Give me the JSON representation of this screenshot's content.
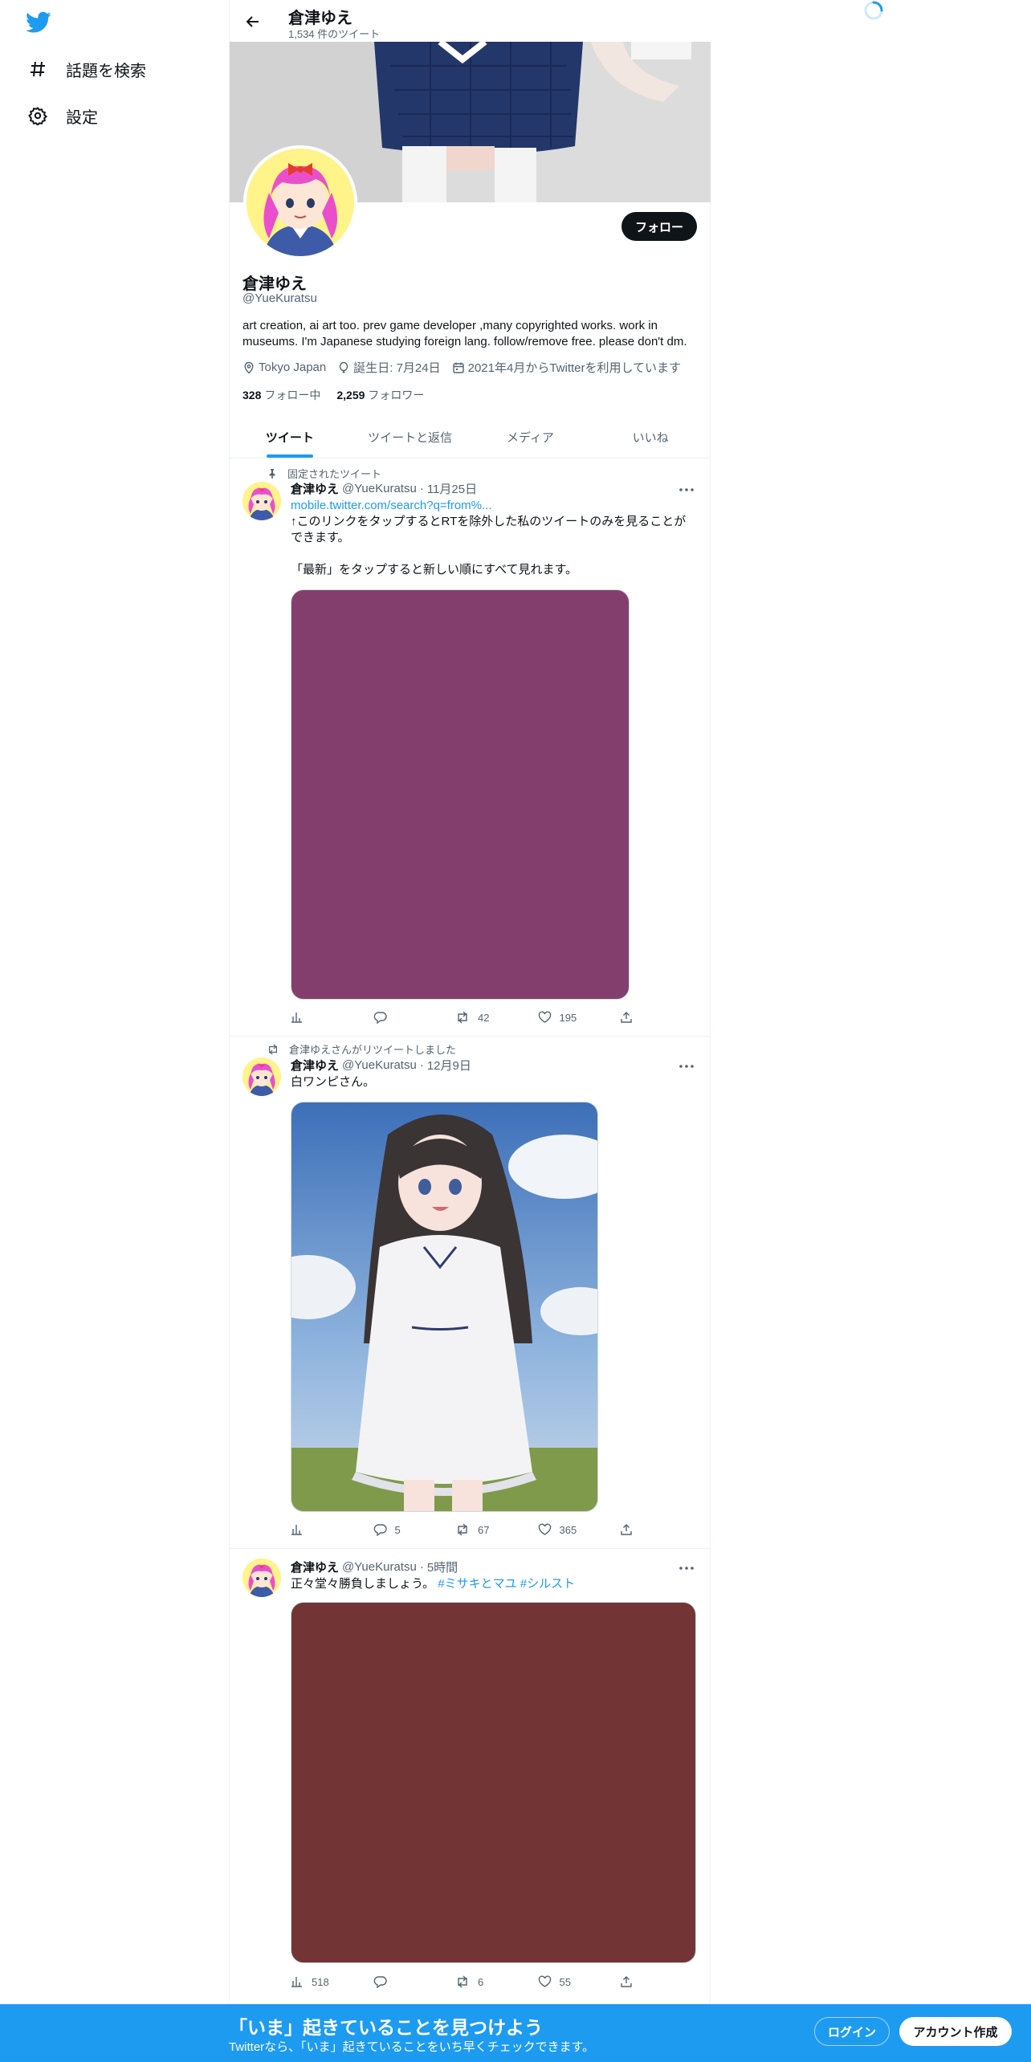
{
  "nav": {
    "items": [
      {
        "label": "話題を検索",
        "icon": "hashtag-icon"
      },
      {
        "label": "設定",
        "icon": "gear-icon"
      }
    ]
  },
  "header": {
    "name": "倉津ゆえ",
    "tweet_count": "1,534 件のツイート"
  },
  "profile": {
    "name": "倉津ゆえ",
    "handle": "@YueKuratsu",
    "bio": "art creation, ai art too. prev game developer ,many copyrighted works. work in museums. I'm Japanese studying foreign lang. follow/remove free. please don't dm.",
    "location": "Tokyo Japan",
    "birthday": "誕生日: 7月24日",
    "joined": "2021年4月からTwitterを利用しています",
    "following_count": "328",
    "following_label": "フォロー中",
    "followers_count": "2,259",
    "followers_label": "フォロワー",
    "follow_button": "フォロー"
  },
  "tabs": [
    {
      "label": "ツイート",
      "active": true
    },
    {
      "label": "ツイートと返信",
      "active": false
    },
    {
      "label": "メディア",
      "active": false
    },
    {
      "label": "いいね",
      "active": false
    }
  ],
  "tweets": [
    {
      "social": "固定されたツイート",
      "name": "倉津ゆえ",
      "handle": "@YueKuratsu",
      "dot": "·",
      "time": "11月25日",
      "link": "mobile.twitter.com/search?q=from%...",
      "text_line1": "↑このリンクをタップするとRTを除外した私のツイートのみを見ることができます。",
      "text_line2": "「最新」をタップすると新しい順にすべて見れます。",
      "media_color": "#843e6e",
      "views": "",
      "replies": "",
      "retweets": "42",
      "likes": "195"
    },
    {
      "social": "倉津ゆえさんがリツイートしました",
      "name": "倉津ゆえ",
      "handle": "@YueKuratsu",
      "dot": "·",
      "time": "12月9日",
      "text": "白ワンピさん。",
      "views": "",
      "replies": "5",
      "retweets": "67",
      "likes": "365"
    },
    {
      "name": "倉津ゆえ",
      "handle": "@YueKuratsu",
      "dot": "·",
      "time": "5時間",
      "text": "正々堂々勝負しましょう。",
      "hashtags": "#ミサキとマユ #シルスト",
      "media_color": "#733436",
      "views": "518",
      "replies": "",
      "retweets": "6",
      "likes": "55"
    }
  ],
  "bottom_bar": {
    "title": "「いま」起きていることを見つけよう",
    "subtitle": "Twitterなら、「いま」起きていることをいち早くチェックできます。",
    "login": "ログイン",
    "signup": "アカウント作成"
  },
  "colors": {
    "brand": "#1d9bf0",
    "text": "#0f1419",
    "muted": "#536471"
  }
}
